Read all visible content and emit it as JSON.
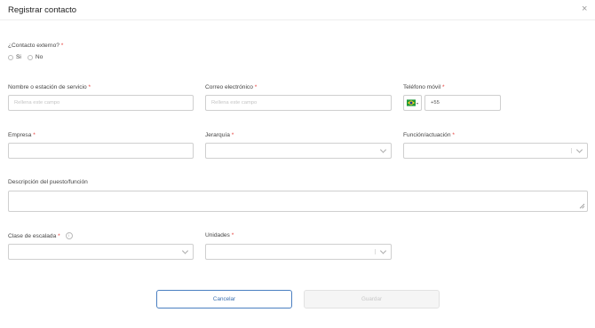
{
  "dialog": {
    "title": "Registrar contacto",
    "close_glyph": "×"
  },
  "external": {
    "label": "¿Contacto externo?",
    "required": "*",
    "options": [
      "Si",
      "No"
    ]
  },
  "fields": {
    "station": {
      "label": "Nombre o estación de servicio",
      "required": "*",
      "placeholder": "Rellena este campo"
    },
    "email": {
      "label": "Correo electrónico",
      "required": "*",
      "placeholder": "Rellena este campo"
    },
    "phone": {
      "label": "Teléfono móvil",
      "required": "*",
      "prefix": "+55",
      "flag_icon": "brazil-flag-icon"
    },
    "company": {
      "label": "Empresa",
      "required": "*"
    },
    "hierarchy": {
      "label": "Jerarquía",
      "required": "*"
    },
    "role": {
      "label": "Función/actuación",
      "required": "*"
    },
    "description": {
      "label": "Descripción del puesto/función"
    },
    "escalation": {
      "label": "Clase de escalada",
      "required": "*",
      "info_icon": "info-icon"
    },
    "units": {
      "label": "Unidades",
      "required": "*"
    }
  },
  "buttons": {
    "cancel": "Cancelar",
    "save": "Guardar"
  },
  "colors": {
    "required": "#e53935",
    "cancel_border": "#4a7fc1",
    "flag_green": "#1f9a3a",
    "flag_yellow": "#ffd21f",
    "flag_blue": "#1c3f94"
  }
}
